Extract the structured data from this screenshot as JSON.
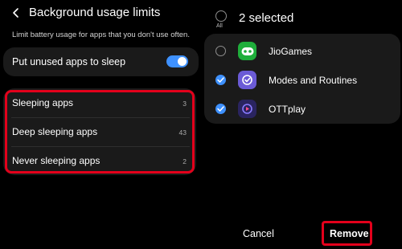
{
  "left": {
    "title": "Background usage limits",
    "subtitle": "Limit battery usage for apps that you don't use often.",
    "sleep_toggle": {
      "label": "Put unused apps to sleep",
      "on": true
    },
    "categories": [
      {
        "label": "Sleeping apps",
        "count": "3"
      },
      {
        "label": "Deep sleeping apps",
        "count": "43"
      },
      {
        "label": "Never sleeping apps",
        "count": "2"
      }
    ]
  },
  "right": {
    "all_label": "All",
    "selected_text": "2 selected",
    "apps": [
      {
        "name": "JioGames",
        "checked": false,
        "icon": "jiogames-icon"
      },
      {
        "name": "Modes and Routines",
        "checked": true,
        "icon": "modes-routines-icon"
      },
      {
        "name": "OTTplay",
        "checked": true,
        "icon": "ottplay-icon"
      }
    ],
    "cancel_label": "Cancel",
    "remove_label": "Remove"
  },
  "colors": {
    "accent": "#3e91ff",
    "highlight": "#e3001b",
    "card": "#1a1a1a",
    "background": "#000000"
  }
}
